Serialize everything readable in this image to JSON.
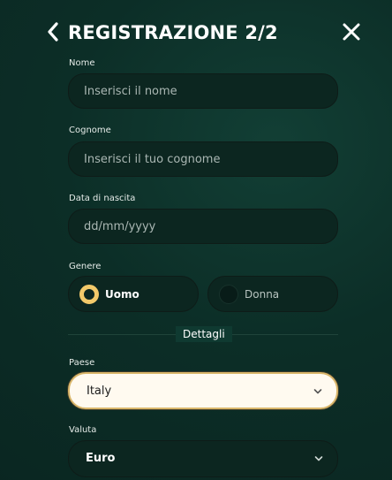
{
  "header": {
    "title": "REGISTRAZIONE 2/2"
  },
  "form": {
    "nome": {
      "label": "Nome",
      "placeholder": "Inserisci il nome"
    },
    "cognome": {
      "label": "Cognome",
      "placeholder": "Inserisci il tuo cognome"
    },
    "data_nascita": {
      "label": "Data di nascita",
      "placeholder": "dd/mm/yyyy"
    },
    "genere": {
      "label": "Genere",
      "options": [
        {
          "label": "Uomo",
          "selected": true
        },
        {
          "label": "Donna",
          "selected": false
        }
      ]
    },
    "dettagli_title": "Dettagli",
    "paese": {
      "label": "Paese",
      "value": "Italy"
    },
    "valuta": {
      "label": "Valuta",
      "value": "Euro"
    }
  },
  "icons": {
    "back": "chevron-left-icon",
    "close": "close-icon",
    "dropdown": "chevron-down-icon"
  },
  "colors": {
    "accent": "#f3c96a",
    "background": "#0c2e27",
    "field": "#0c2620"
  }
}
